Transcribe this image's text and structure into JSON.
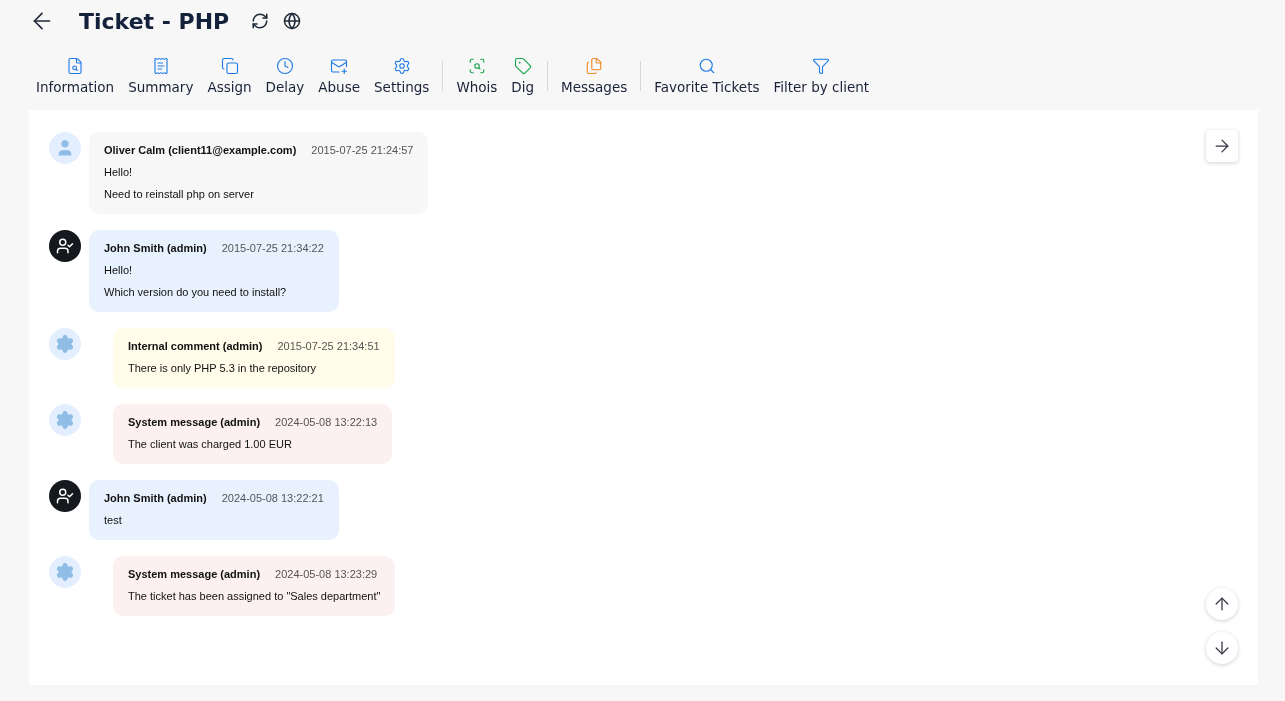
{
  "header": {
    "title": "Ticket - PHP"
  },
  "toolbar": [
    {
      "items": [
        {
          "label": "Information"
        },
        {
          "label": "Summary"
        },
        {
          "label": "Assign"
        },
        {
          "label": "Delay"
        },
        {
          "label": "Abuse"
        },
        {
          "label": "Settings"
        }
      ]
    },
    {
      "items": [
        {
          "label": "Whois"
        },
        {
          "label": "Dig"
        }
      ]
    },
    {
      "items": [
        {
          "label": "Messages"
        }
      ]
    },
    {
      "items": [
        {
          "label": "Favorite Tickets"
        },
        {
          "label": "Filter by client"
        }
      ]
    }
  ],
  "messages": [
    {
      "kind": "client",
      "author": "Oliver Calm (client11@example.com)",
      "time": "2015-07-25 21:24:57",
      "lines": [
        "Hello!",
        "Need to reinstall php on server"
      ]
    },
    {
      "kind": "admin",
      "author": "John Smith (admin)",
      "time": "2015-07-25 21:34:22",
      "lines": [
        "Hello!",
        "Which version do you need to install?"
      ]
    },
    {
      "kind": "internal",
      "author": "Internal comment (admin)",
      "time": "2015-07-25 21:34:51",
      "lines": [
        "There is only PHP 5.3 in the repository"
      ]
    },
    {
      "kind": "system",
      "author": "System message (admin)",
      "time": "2024-05-08 13:22:13",
      "lines": [
        "The client was charged 1.00 EUR"
      ]
    },
    {
      "kind": "admin",
      "author": "John Smith (admin)",
      "time": "2024-05-08 13:22:21",
      "lines": [
        "test"
      ]
    },
    {
      "kind": "system",
      "author": "System message (admin)",
      "time": "2024-05-08 13:23:29",
      "lines": [
        "The ticket has been assigned to \"Sales department\""
      ]
    }
  ]
}
